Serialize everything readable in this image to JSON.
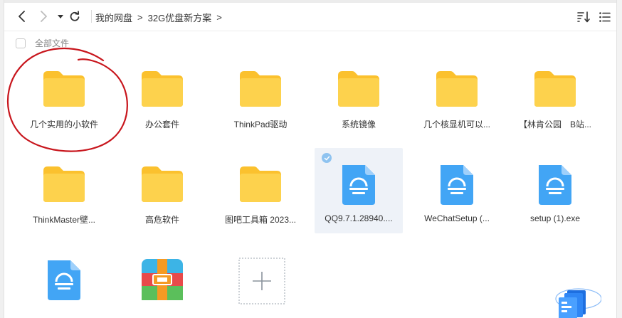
{
  "breadcrumb": {
    "items": [
      "我的网盘",
      "32G优盘新方案"
    ],
    "separator": ">"
  },
  "select_all": {
    "label": "全部文件"
  },
  "items": [
    {
      "label": "几个实用的小软件",
      "type": "folder",
      "selected": false
    },
    {
      "label": "办公套件",
      "type": "folder",
      "selected": false
    },
    {
      "label": "ThinkPad驱动",
      "type": "folder",
      "selected": false
    },
    {
      "label": "系统镜像",
      "type": "folder",
      "selected": false
    },
    {
      "label": "几个核显机可以...",
      "type": "folder",
      "selected": false
    },
    {
      "label": "【林肯公园　B站...",
      "type": "folder",
      "selected": false
    },
    {
      "label": "ThinkMaster壁...",
      "type": "folder",
      "selected": false
    },
    {
      "label": "高危软件",
      "type": "folder",
      "selected": false
    },
    {
      "label": "图吧工具箱 2023...",
      "type": "folder",
      "selected": false
    },
    {
      "label": "QQ9.7.1.28940....",
      "type": "exe-file",
      "selected": true
    },
    {
      "label": "WeChatSetup (...",
      "type": "exe-file",
      "selected": false
    },
    {
      "label": "setup (1).exe",
      "type": "exe-file",
      "selected": false
    },
    {
      "label": "",
      "type": "exe-file",
      "selected": false
    },
    {
      "label": "",
      "type": "archive-file",
      "selected": false
    },
    {
      "label": "",
      "type": "add-new",
      "selected": false
    }
  ],
  "icons": {
    "back": "back-arrow-icon",
    "forward": "forward-arrow-icon",
    "history": "history-dropdown-icon",
    "refresh": "refresh-icon",
    "sort": "sort-icon",
    "list_view": "list-view-icon"
  },
  "colors": {
    "folder": "#fdd24d",
    "folder_tab": "#fbc12e",
    "exe_blue": "#42a5f5",
    "selection_bg": "#eef2f8",
    "annotation_red": "#c8161d"
  }
}
